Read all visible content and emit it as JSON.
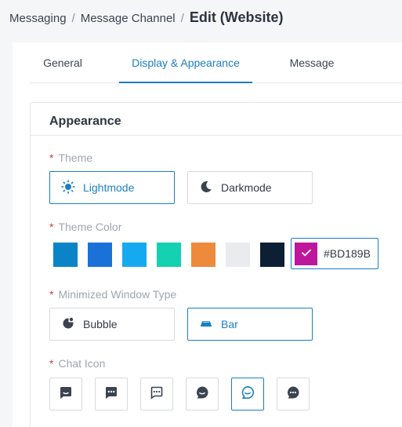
{
  "breadcrumb": {
    "items": [
      "Messaging",
      "Message Channel"
    ],
    "separator": "/",
    "current": "Edit (Website)"
  },
  "tabs": [
    {
      "label": "General",
      "active": false
    },
    {
      "label": "Display & Appearance",
      "active": true
    },
    {
      "label": "Message",
      "active": false
    }
  ],
  "appearance": {
    "title": "Appearance",
    "required_mark": "*",
    "theme": {
      "label": "Theme",
      "options": [
        {
          "label": "Lightmode",
          "icon": "sun-icon",
          "selected": true
        },
        {
          "label": "Darkmode",
          "icon": "moon-icon",
          "selected": false
        }
      ]
    },
    "theme_color": {
      "label": "Theme Color",
      "swatches": [
        "#0a84c6",
        "#1a72d9",
        "#17a9ef",
        "#14d1b1",
        "#ee8a3c",
        "#e9ebef",
        "#0c1f33"
      ],
      "selected_value": "#BD189B",
      "selected_color": "#bd189b"
    },
    "minimized_window_type": {
      "label": "Minimized Window Type",
      "options": [
        {
          "label": "Bubble",
          "icon": "bubble-icon",
          "selected": false
        },
        {
          "label": "Bar",
          "icon": "bar-icon",
          "selected": true
        }
      ]
    },
    "chat_icon": {
      "label": "Chat Icon",
      "options": [
        {
          "icon": "chat-smile-square-icon",
          "selected": false
        },
        {
          "icon": "chat-dots-square-icon",
          "selected": false
        },
        {
          "icon": "chat-dots-outline-icon",
          "selected": false
        },
        {
          "icon": "chat-smile-round-icon",
          "selected": false
        },
        {
          "icon": "chat-smile-outline-icon",
          "selected": true
        },
        {
          "icon": "chat-dots-round-icon",
          "selected": false
        }
      ]
    }
  },
  "colors": {
    "accent": "#1b7fc0",
    "required": "#d23c3c",
    "label": "#9ea6b0",
    "icon_dark": "#3b4350"
  }
}
